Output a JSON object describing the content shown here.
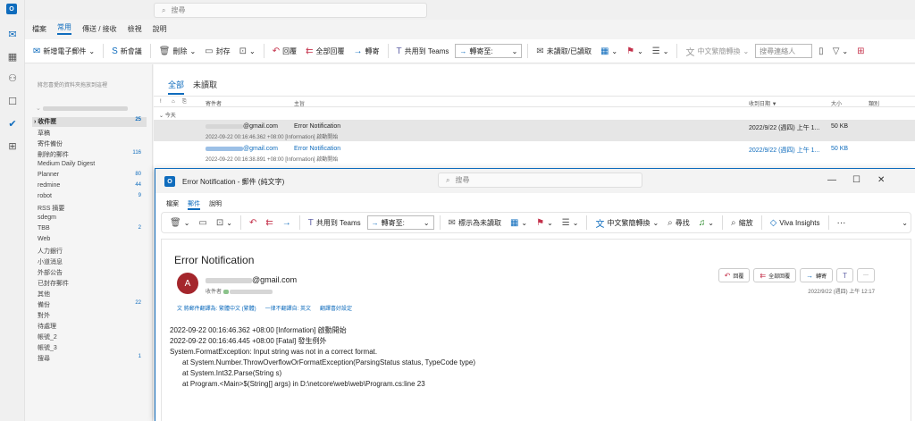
{
  "rail": {
    "logo": "O",
    "icons": [
      "mail-icon",
      "calendar-icon",
      "people-icon",
      "tasks-icon",
      "todo-icon",
      "apps-icon"
    ]
  },
  "top": {
    "search_placeholder": "搜尋"
  },
  "menu": [
    "檔案",
    "常用",
    "傳送 / 接收",
    "檢視",
    "說明"
  ],
  "ribbon": {
    "new_email": "新增電子郵件",
    "new_meeting": "新會議",
    "delete": "刪除",
    "archive": "封存",
    "reply": "回覆",
    "reply_all": "全部回覆",
    "forward": "轉寄",
    "share_teams": "共用到 Teams",
    "move_to": "轉寄至:",
    "unread_read": "未讀取/已讀取",
    "translate": "中文繁簡轉換",
    "search_people": "搜尋連絡人"
  },
  "folders": {
    "fav_hint": "將您喜愛的資料夾拖放到這裡",
    "account": "olivia.chen@hm.com.tw",
    "inbox": "收件匣",
    "inbox_count": "25",
    "items": [
      {
        "label": "草稿",
        "count": ""
      },
      {
        "label": "寄件備份",
        "count": ""
      },
      {
        "label": "刪除的郵件",
        "count": "116"
      },
      {
        "label": "Medium Daily Digest",
        "count": ""
      },
      {
        "label": "Planner",
        "count": "80"
      },
      {
        "label": "redmine",
        "count": "44"
      },
      {
        "label": "robot",
        "count": "9"
      },
      {
        "label": "RSS 摘要",
        "count": ""
      },
      {
        "label": "sdegm",
        "count": ""
      },
      {
        "label": "TBB",
        "count": "2"
      },
      {
        "label": "Web",
        "count": ""
      },
      {
        "label": "人力銀行",
        "count": ""
      },
      {
        "label": "小道消息",
        "count": ""
      },
      {
        "label": "外部公告",
        "count": ""
      },
      {
        "label": "已封存郵件",
        "count": ""
      },
      {
        "label": "其他",
        "count": ""
      },
      {
        "label": "備份",
        "count": "22"
      },
      {
        "label": "對外",
        "count": ""
      },
      {
        "label": "待處理",
        "count": ""
      },
      {
        "label": "帳號_2",
        "count": ""
      },
      {
        "label": "帳號_3",
        "count": ""
      },
      {
        "label": "搜尋",
        "count": "1"
      }
    ]
  },
  "list": {
    "tabs": [
      "全部",
      "未讀取"
    ],
    "columns": {
      "from": "寄件者",
      "subject": "主旨",
      "received": "收到日期 ▼",
      "size": "大小",
      "category": "類別"
    },
    "group": "今天",
    "rows": [
      {
        "from": "@gmail.com",
        "subject": "Error Notification",
        "preview": "2022-09-22 00:16:46.362 +08:00 [Information] 啟動開始",
        "date": "2022/9/22 (週四) 上午 1...",
        "size": "50 KB"
      },
      {
        "from": "@gmail.com",
        "subject": "Error Notification",
        "preview": "2022-09-22 00:16:38.891 +08:00 [Information] 啟動開始",
        "date": "2022/9/22 (週四) 上午 1...",
        "size": "50 KB"
      }
    ]
  },
  "reader": {
    "title": "Error Notification  -  郵件 (純文字)",
    "search_placeholder": "搜尋",
    "menu": [
      "檔案",
      "郵件",
      "說明"
    ],
    "ribbon": {
      "share_teams": "共用到 Teams",
      "move_to": "轉寄至:",
      "mark_unread": "標示為未讀取",
      "translate": "中文繁簡轉換",
      "find": "尋找",
      "zoom": "縮放",
      "viva": "Viva Insights"
    },
    "subject": "Error Notification",
    "avatar": "A",
    "sender": "@gmail.com",
    "recipient_label": "收件者",
    "translate_msg": "將郵件翻譯為: 繁體中文 (繁體)",
    "never_translate": "一律不翻譯自: 英文",
    "translate_pref": "翻譯喜好設定",
    "reply": "回覆",
    "reply_all": "全部回覆",
    "forward": "轉寄",
    "date": "2022/9/22 (週四) 上午 12:17",
    "lines": [
      "2022-09-22 00:16:46.362 +08:00 [Information]  啟動開始",
      "2022-09-22 00:16:46.445 +08:00 [Fatal]  發生例外",
      "System.FormatException: Input string was not in a correct format.",
      "at System.Number.ThrowOverflowOrFormatException(ParsingStatus status, TypeCode type)",
      "at System.Int32.Parse(String s)",
      "at Program.<Main>$(String[] args) in D:\\netcore\\web\\web\\Program.cs:line 23"
    ]
  }
}
